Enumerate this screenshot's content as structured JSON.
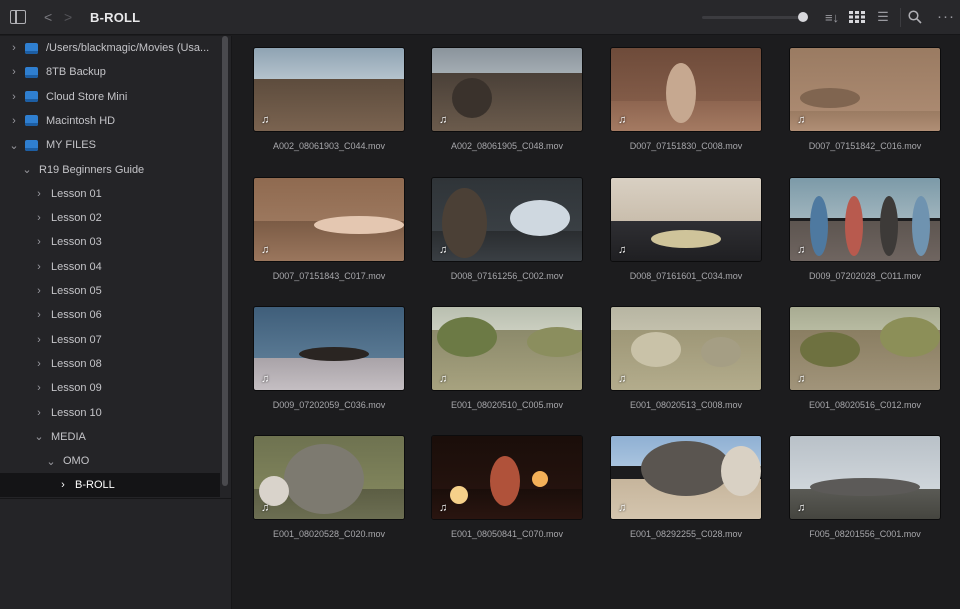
{
  "toolbar": {
    "title": "B-ROLL",
    "back_glyph": "<",
    "forward_glyph": ">",
    "sort_glyph": "≡↓",
    "list_glyph": "☰",
    "more_glyph": "···"
  },
  "sidebar": {
    "drives": [
      {
        "label": "/Users/blackmagic/Movies (Usa..."
      },
      {
        "label": "8TB Backup"
      },
      {
        "label": "Cloud Store Mini"
      },
      {
        "label": "Macintosh HD"
      },
      {
        "label": "MY FILES"
      }
    ],
    "folders": [
      {
        "label": "R19 Beginners Guide"
      },
      {
        "label": "Lesson 01"
      },
      {
        "label": "Lesson 02"
      },
      {
        "label": "Lesson 03"
      },
      {
        "label": "Lesson 04"
      },
      {
        "label": "Lesson 05"
      },
      {
        "label": "Lesson 06"
      },
      {
        "label": "Lesson 07"
      },
      {
        "label": "Lesson 08"
      },
      {
        "label": "Lesson 09"
      },
      {
        "label": "Lesson 10"
      },
      {
        "label": "MEDIA"
      },
      {
        "label": "OMO"
      },
      {
        "label": "B-ROLL"
      }
    ],
    "chevron_right": "›",
    "chevron_down": "⌄"
  },
  "clips": [
    {
      "name": "A002_08061903_C044.mov"
    },
    {
      "name": "A002_08061905_C048.mov"
    },
    {
      "name": "D007_07151830_C008.mov"
    },
    {
      "name": "D007_07151842_C016.mov"
    },
    {
      "name": "D007_07151843_C017.mov"
    },
    {
      "name": "D008_07161256_C002.mov"
    },
    {
      "name": "D008_07161601_C034.mov"
    },
    {
      "name": "D009_07202028_C011.mov"
    },
    {
      "name": "D009_07202059_C036.mov"
    },
    {
      "name": "E001_08020510_C005.mov"
    },
    {
      "name": "E001_08020513_C008.mov"
    },
    {
      "name": "E001_08020516_C012.mov"
    },
    {
      "name": "E001_08020528_C020.mov"
    },
    {
      "name": "E001_08050841_C070.mov"
    },
    {
      "name": "E001_08292255_C028.mov"
    },
    {
      "name": "F005_08201556_C001.mov"
    }
  ],
  "audio_badge_glyph": "♫",
  "colors": {
    "accent_drive": "#2f7fd0",
    "toolbar_bg": "#28282b",
    "sidebar_bg": "#242427",
    "content_bg": "#1c1c1e",
    "selected_row_bg": "#141416"
  }
}
